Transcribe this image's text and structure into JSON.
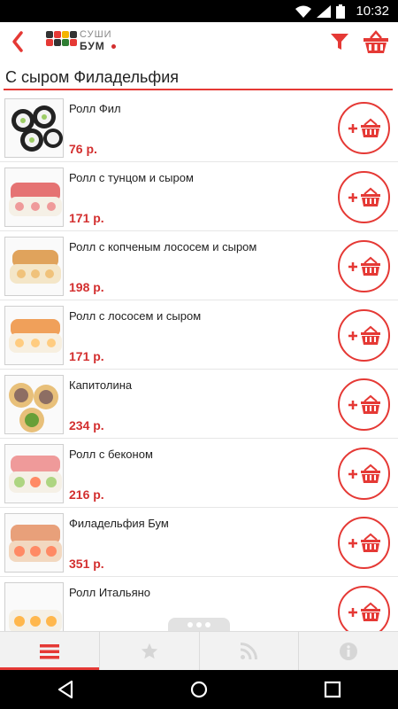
{
  "statusbar": {
    "time": "10:32",
    "icons": [
      "wifi-icon",
      "signal-icon",
      "battery-icon"
    ]
  },
  "appbar": {
    "logo_line1": "СУШИ",
    "logo_line2": "БУМ",
    "accent": "#e53935"
  },
  "category": {
    "title": "С сыром Филадельфия"
  },
  "items": [
    {
      "name": "Ролл Фил",
      "price": "76 р."
    },
    {
      "name": "Ролл с тунцом и сыром",
      "price": "171 р."
    },
    {
      "name": "Ролл с копченым лососем и сыром",
      "price": "198 р."
    },
    {
      "name": "Ролл с лососем и сыром",
      "price": "171 р."
    },
    {
      "name": "Капитолина",
      "price": "234 р."
    },
    {
      "name": "Ролл с беконом",
      "price": "216 р."
    },
    {
      "name": "Филадельфия Бум",
      "price": "351 р."
    },
    {
      "name": "Ролл Итальяно",
      "price": ""
    }
  ],
  "tabs": [
    {
      "icon": "menu-icon",
      "active": true
    },
    {
      "icon": "star-icon",
      "active": false
    },
    {
      "icon": "rss-icon",
      "active": false
    },
    {
      "icon": "info-icon",
      "active": false
    }
  ],
  "navbar": [
    "back-nav-icon",
    "home-nav-icon",
    "recents-nav-icon"
  ]
}
